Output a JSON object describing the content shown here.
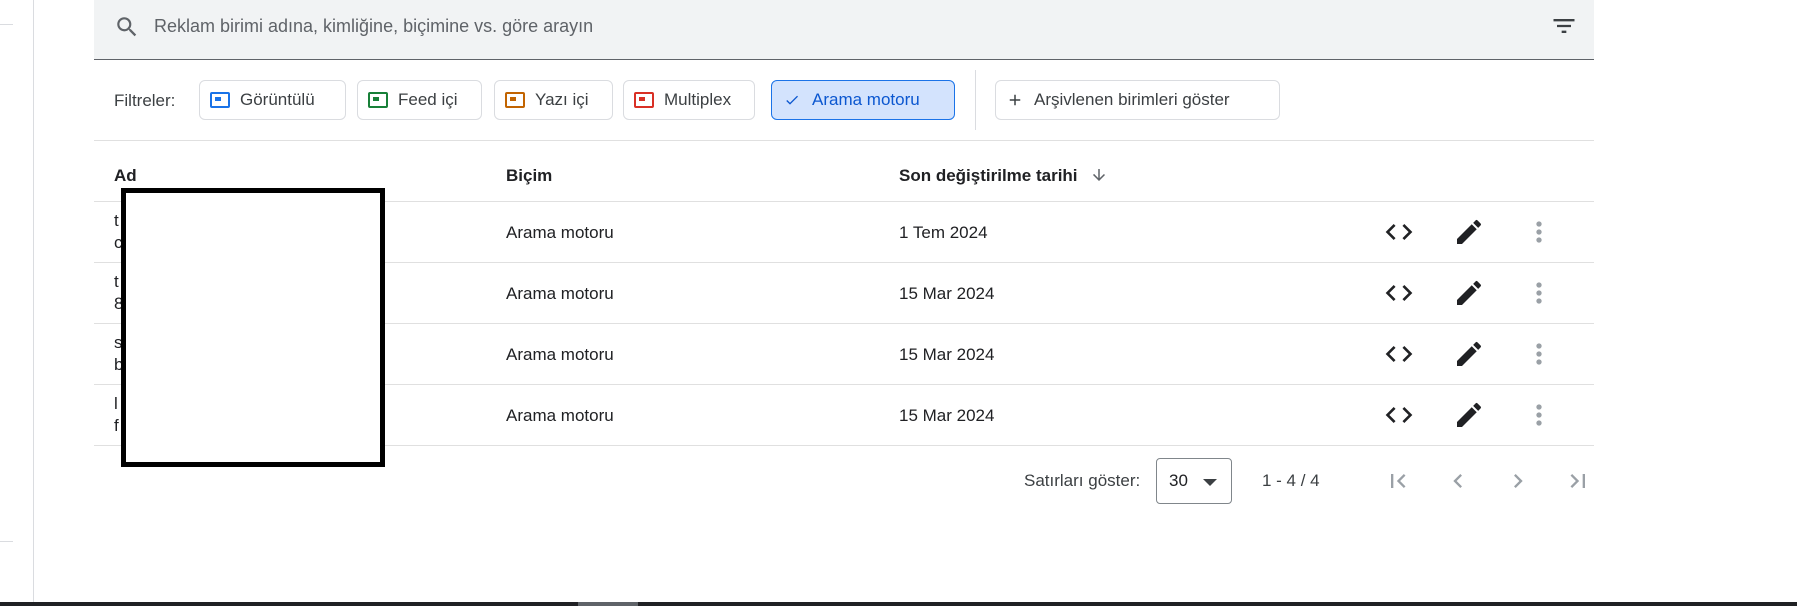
{
  "search": {
    "placeholder": "Reklam birimi adına, kimliğine, biçimine vs. göre arayın",
    "search_icon": "search-icon",
    "filter_icon": "filter-list-icon"
  },
  "filters": {
    "label": "Filtreler:",
    "chips": [
      {
        "label": "Görüntülü",
        "icon": "display-format-icon",
        "color": "#1a73e8",
        "selected": false
      },
      {
        "label": "Feed içi",
        "icon": "in-feed-format-icon",
        "color": "#188038",
        "selected": false
      },
      {
        "label": "Yazı içi",
        "icon": "in-article-format-icon",
        "color": "#c26401",
        "selected": false
      },
      {
        "label": "Multiplex",
        "icon": "multiplex-format-icon",
        "color": "#d93025",
        "selected": false
      },
      {
        "label": "Arama motoru",
        "icon": "check-icon",
        "color": "#0b57d0",
        "selected": true
      }
    ],
    "archive_button": {
      "label": "Arşivlenen birimleri göster",
      "icon": "plus-icon"
    }
  },
  "table": {
    "columns": {
      "name": "Ad",
      "format": "Biçim",
      "modified": "Son değiştirilme tarihi",
      "sort_icon": "arrow-downward-icon"
    },
    "rows": [
      {
        "name_line1": "t",
        "name_line2": "c",
        "format": "Arama motoru",
        "modified": "1 Tem 2024"
      },
      {
        "name_line1": "t",
        "name_line2": "8",
        "format": "Arama motoru",
        "modified": "15 Mar 2024"
      },
      {
        "name_line1": "s",
        "name_line2": "b",
        "format": "Arama motoru",
        "modified": "15 Mar 2024"
      },
      {
        "name_line1": "l",
        "name_line2": "f",
        "format": "Arama motoru",
        "modified": "15 Mar 2024"
      }
    ],
    "row_actions": [
      "code-icon",
      "edit-pencil-icon",
      "more-vert-icon"
    ]
  },
  "pagination": {
    "rows_label": "Satırları göster:",
    "rows_per_page": "30",
    "range": "1 - 4 / 4",
    "nav_icons": [
      "first-page-icon",
      "chevron-left-icon",
      "chevron-right-icon",
      "last-page-icon"
    ]
  },
  "colors": {
    "accent": "#1a73e8",
    "selected_chip_bg": "#d3e3fd",
    "search_bg": "#f1f3f4"
  }
}
